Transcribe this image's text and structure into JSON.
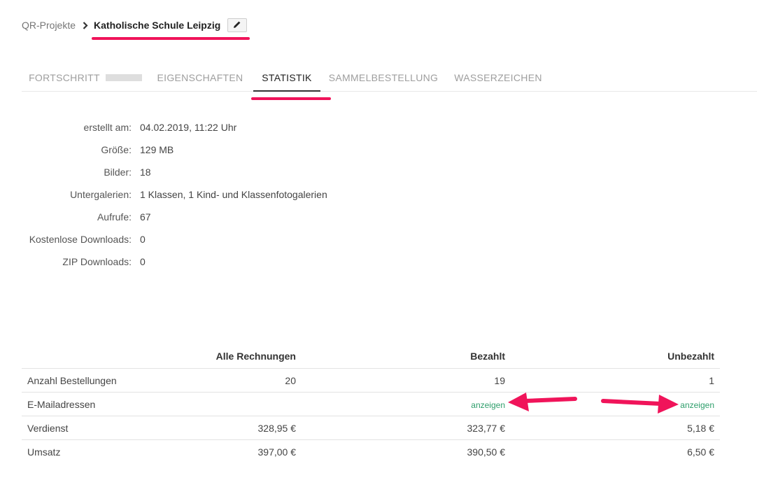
{
  "breadcrumb": {
    "parent": "QR-Projekte",
    "current": "Katholische Schule Leipzig",
    "separator_icon": "chevron-right-icon",
    "edit_icon": "pencil-icon"
  },
  "tabs": [
    {
      "label": "FORTSCHRITT",
      "active": false,
      "progress": 0.0
    },
    {
      "label": "EIGENSCHAFTEN",
      "active": false
    },
    {
      "label": "STATISTIK",
      "active": true
    },
    {
      "label": "SAMMELBESTELLUNG",
      "active": false
    },
    {
      "label": "WASSERZEICHEN",
      "active": false
    }
  ],
  "stats": [
    {
      "label": "erstellt am:",
      "value": "04.02.2019, 11:22 Uhr"
    },
    {
      "label": "Größe:",
      "value": "129 MB"
    },
    {
      "label": "Bilder:",
      "value": "18"
    },
    {
      "label": "Untergalerien:",
      "value": "1 Klassen, 1 Kind- und Klassenfotogalerien"
    },
    {
      "label": "Aufrufe:",
      "value": "67"
    },
    {
      "label": "Kostenlose Downloads:",
      "value": "0"
    },
    {
      "label": "ZIP Downloads:",
      "value": "0"
    }
  ],
  "table": {
    "headers": [
      "",
      "Alle Rechnungen",
      "Bezahlt",
      "Unbezahlt"
    ],
    "rows": [
      [
        "Anzahl Bestellungen",
        "20",
        "19",
        "1"
      ],
      [
        "E-Mailadressen",
        "",
        "anzeigen",
        "anzeigen"
      ],
      [
        "Verdienst",
        "328,95 €",
        "323,77 €",
        "5,18 €"
      ],
      [
        "Umsatz",
        "397,00 €",
        "390,50 €",
        "6,50 €"
      ]
    ]
  },
  "colors": {
    "annotation": "#f0145a",
    "link": "#2e9e6b",
    "tab_inactive": "#9e9e9e"
  }
}
